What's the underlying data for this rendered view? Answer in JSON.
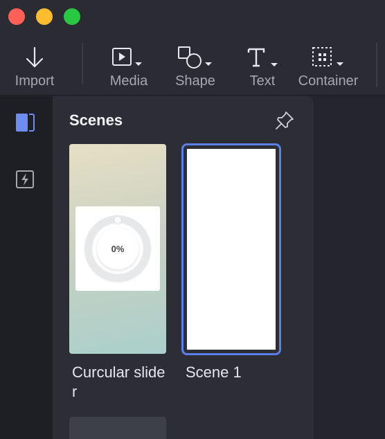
{
  "toolbar": {
    "import": "Import",
    "media": "Media",
    "shape": "Shape",
    "text": "Text",
    "container": "Container"
  },
  "panel": {
    "title": "Scenes",
    "scenes": [
      {
        "name": "Curcular slider",
        "preview_text": "0%"
      },
      {
        "name": "Scene 1"
      }
    ]
  },
  "colors": {
    "accent": "#5a7fe6",
    "close": "#fe5f57",
    "minimize": "#febc2e",
    "maximize": "#28c840"
  },
  "icons": [
    "import-icon",
    "media-icon",
    "shape-icon",
    "text-icon",
    "container-icon",
    "scenes-panel-icon",
    "interactions-icon",
    "pin-icon"
  ]
}
